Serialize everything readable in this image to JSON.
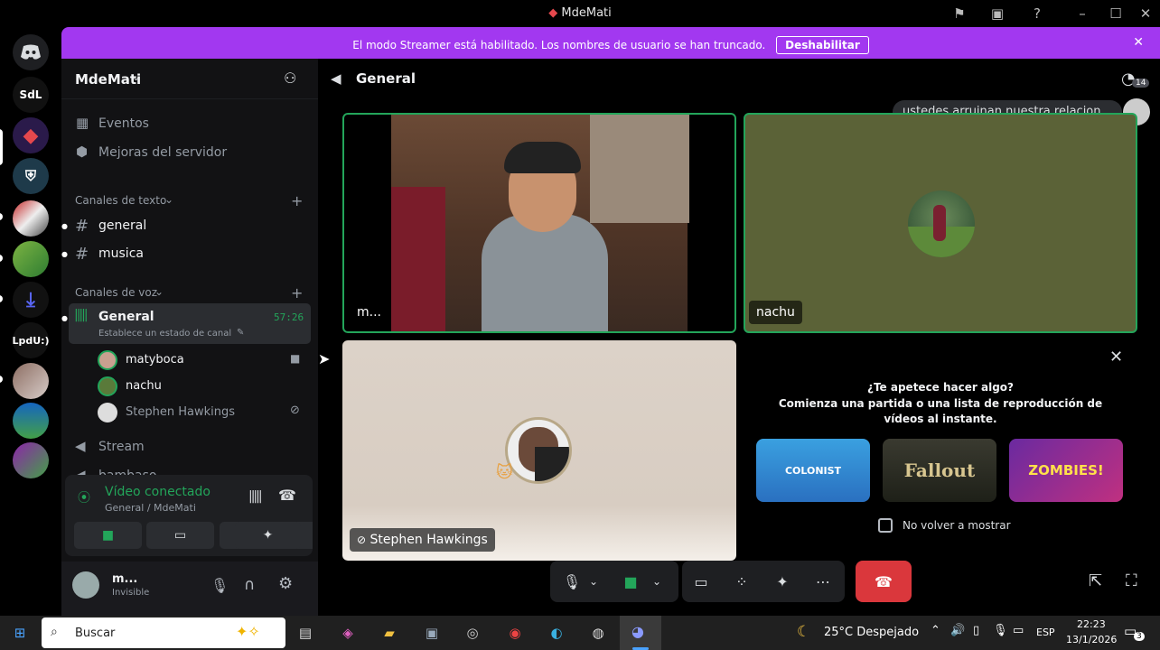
{
  "window": {
    "title": "MdeMati"
  },
  "banner": {
    "message": "El modo Streamer está habilitado. Los nombres de usuario se han truncado.",
    "button": "Deshabilitar"
  },
  "rail": {
    "items": [
      "SdL",
      "LpdU:)"
    ]
  },
  "server": {
    "name": "MdeMati"
  },
  "sidebar": {
    "events": "Eventos",
    "boosts": "Mejoras del servidor",
    "text_category": "Canales de texto",
    "text_channels": [
      "general",
      "musica"
    ],
    "voice_category": "Canales de voz",
    "voice_channel": {
      "name": "General",
      "timer": "57:26",
      "status": "Establece un estado de canal"
    },
    "members": [
      "matyboca",
      "nachu",
      "Stephen Hawkings"
    ],
    "stream_channel": "Stream",
    "partial_channel": "bambaso"
  },
  "connection": {
    "status": "Vídeo conectado",
    "location": "General / MdeMati"
  },
  "user": {
    "name": "m...",
    "status": "Invisible"
  },
  "stage": {
    "channel": "General",
    "online_count": "14",
    "chat_preview": "ustedes arruinan nuestra relacion...",
    "tiles": [
      {
        "name": "m..."
      },
      {
        "name": "nachu"
      },
      {
        "name": "Stephen Hawkings"
      }
    ],
    "activity": {
      "question": "¿Te apetece hacer algo?",
      "subtitle": "Comienza una partida o una lista de reproducción de vídeos al instante.",
      "games": [
        "COLONIST",
        "Fallout",
        "ZOMBIES!"
      ],
      "dont_show": "No volver a mostrar"
    }
  },
  "taskbar": {
    "search": "Buscar",
    "weather": "25°C  Despejado",
    "lang": "ESP",
    "time": "22:23",
    "date": "13/1/2026",
    "notif_count": "3"
  },
  "colors": {
    "accent": "#a238f0",
    "speaking": "#23a55a",
    "end_call": "#da373c",
    "sidebar": "#121214"
  }
}
